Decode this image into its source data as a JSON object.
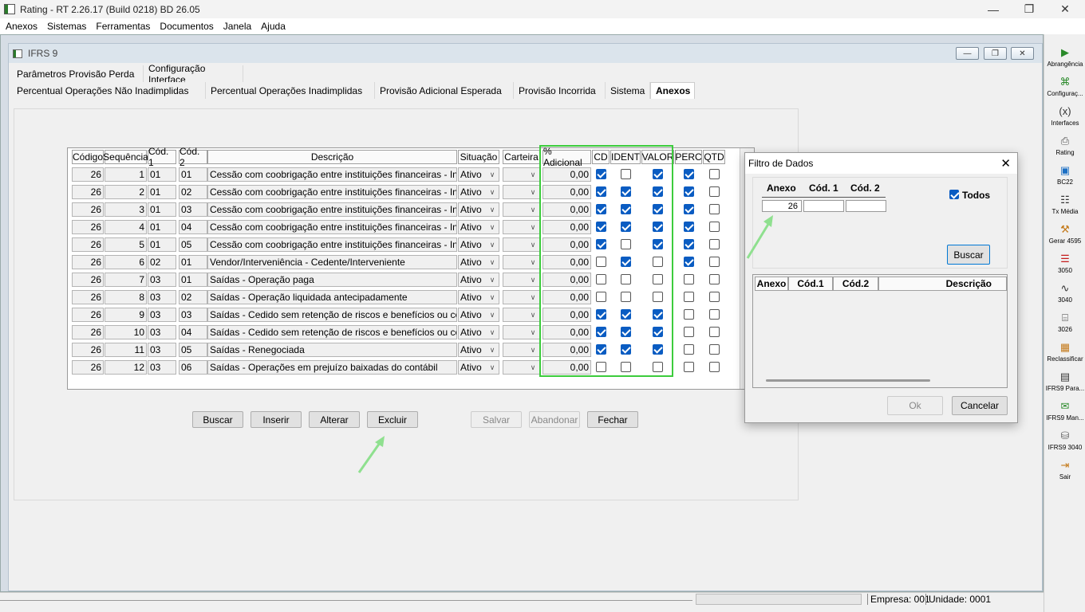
{
  "window": {
    "title": "Rating - RT 2.26.17 (Build 0218) BD 26.05"
  },
  "menu": [
    "Anexos",
    "Sistemas",
    "Ferramentas",
    "Documentos",
    "Janela",
    "Ajuda"
  ],
  "child": {
    "title": "IFRS 9"
  },
  "tabs_row1": [
    "Parâmetros Provisão Perda",
    "Configuração Interface"
  ],
  "tabs_row2": [
    "Percentual Operações Não Inadimplidas",
    "Percentual Operações Inadimplidas",
    "Provisão Adicional Esperada",
    "Provisão Incorrida",
    "Sistema",
    "Anexos"
  ],
  "active_tab": "Anexos",
  "grid": {
    "headers": [
      "Código",
      "Sequência",
      "Cód. 1",
      "Cód. 2",
      "Descrição",
      "Situação",
      "Carteira",
      "% Adicional",
      "CD",
      "IDENT",
      "VALOR",
      "PERC",
      "QTD"
    ],
    "rows": [
      {
        "codigo": "26",
        "seq": "1",
        "cod1": "01",
        "cod2": "01",
        "desc": "Cessão com coobrigação entre instituições financeiras - Informaç",
        "sit": "Ativo",
        "cart": "",
        "pct": "0,00",
        "cd": true,
        "ident": false,
        "valor": true,
        "perc": true,
        "qtd": false
      },
      {
        "codigo": "26",
        "seq": "2",
        "cod1": "01",
        "cod2": "02",
        "desc": "Cessão com coobrigação entre instituições financeiras - Informaç",
        "sit": "Ativo",
        "cart": "",
        "pct": "0,00",
        "cd": true,
        "ident": true,
        "valor": true,
        "perc": true,
        "qtd": false
      },
      {
        "codigo": "26",
        "seq": "3",
        "cod1": "01",
        "cod2": "03",
        "desc": "Cessão com coobrigação entre instituições financeiras - Informaç",
        "sit": "Ativo",
        "cart": "",
        "pct": "0,00",
        "cd": true,
        "ident": true,
        "valor": true,
        "perc": true,
        "qtd": false
      },
      {
        "codigo": "26",
        "seq": "4",
        "cod1": "01",
        "cod2": "04",
        "desc": "Cessão com coobrigação entre instituições financeiras - Informaç",
        "sit": "Ativo",
        "cart": "",
        "pct": "0,00",
        "cd": true,
        "ident": true,
        "valor": true,
        "perc": true,
        "qtd": false
      },
      {
        "codigo": "26",
        "seq": "5",
        "cod1": "01",
        "cod2": "05",
        "desc": "Cessão com coobrigação entre instituições financeiras -  Informaç",
        "sit": "Ativo",
        "cart": "",
        "pct": "0,00",
        "cd": true,
        "ident": false,
        "valor": true,
        "perc": true,
        "qtd": false
      },
      {
        "codigo": "26",
        "seq": "6",
        "cod1": "02",
        "cod2": "01",
        "desc": "Vendor/Interveniência - Cedente/Interveniente",
        "sit": "Ativo",
        "cart": "",
        "pct": "0,00",
        "cd": false,
        "ident": true,
        "valor": false,
        "perc": true,
        "qtd": false
      },
      {
        "codigo": "26",
        "seq": "7",
        "cod1": "03",
        "cod2": "01",
        "desc": "Saídas - Operação paga",
        "sit": "Ativo",
        "cart": "",
        "pct": "0,00",
        "cd": false,
        "ident": false,
        "valor": false,
        "perc": false,
        "qtd": false
      },
      {
        "codigo": "26",
        "seq": "8",
        "cod1": "03",
        "cod2": "02",
        "desc": "Saídas - Operação liquidada antecipadamente",
        "sit": "Ativo",
        "cart": "",
        "pct": "0,00",
        "cd": false,
        "ident": false,
        "valor": false,
        "perc": false,
        "qtd": false
      },
      {
        "codigo": "26",
        "seq": "9",
        "cod1": "03",
        "cod2": "03",
        "desc": "Saídas - Cedido sem retenção de riscos e benefícios ou controle",
        "sit": "Ativo",
        "cart": "",
        "pct": "0,00",
        "cd": true,
        "ident": true,
        "valor": true,
        "perc": false,
        "qtd": false
      },
      {
        "codigo": "26",
        "seq": "10",
        "cod1": "03",
        "cod2": "04",
        "desc": "Saídas - Cedido sem retenção de riscos e benefícios ou controle",
        "sit": "Ativo",
        "cart": "",
        "pct": "0,00",
        "cd": true,
        "ident": true,
        "valor": true,
        "perc": false,
        "qtd": false
      },
      {
        "codigo": "26",
        "seq": "11",
        "cod1": "03",
        "cod2": "05",
        "desc": "Saídas - Renegociada",
        "sit": "Ativo",
        "cart": "",
        "pct": "0,00",
        "cd": true,
        "ident": true,
        "valor": true,
        "perc": false,
        "qtd": false
      },
      {
        "codigo": "26",
        "seq": "12",
        "cod1": "03",
        "cod2": "06",
        "desc": "Saídas - Operações em prejuízo baixadas do contábil",
        "sit": "Ativo",
        "cart": "",
        "pct": "0,00",
        "cd": false,
        "ident": false,
        "valor": false,
        "perc": false,
        "qtd": false
      }
    ]
  },
  "buttons": {
    "buscar": "Buscar",
    "inserir": "Inserir",
    "alterar": "Alterar",
    "excluir": "Excluir",
    "salvar": "Salvar",
    "abandonar": "Abandonar",
    "fechar": "Fechar"
  },
  "sidebar": [
    {
      "label": "Abrangência",
      "icon": "arrow-right-icon"
    },
    {
      "label": "Configuraç...",
      "icon": "grid-config-icon"
    },
    {
      "label": "Interfaces",
      "icon": "function-icon"
    },
    {
      "label": "Rating",
      "icon": "printer-icon"
    },
    {
      "label": "BC22",
      "icon": "cube-icon"
    },
    {
      "label": "Tx Média",
      "icon": "network-icon"
    },
    {
      "label": "Gerar 4595",
      "icon": "wrench-icon"
    },
    {
      "label": "3050",
      "icon": "stack-icon"
    },
    {
      "label": "3040",
      "icon": "pulse-icon"
    },
    {
      "label": "3026",
      "icon": "document-icon"
    },
    {
      "label": "Reclassificar",
      "icon": "table-icon"
    },
    {
      "label": "IFRS9 Para...",
      "icon": "spreadsheet-icon"
    },
    {
      "label": "IFRS9 Man...",
      "icon": "email-icon"
    },
    {
      "label": "IFRS9 3040",
      "icon": "database-icon"
    },
    {
      "label": "Sair",
      "icon": "exit-icon"
    }
  ],
  "status": {
    "empresa": "Empresa: 001",
    "unidade": "Unidade: 0001"
  },
  "dialog": {
    "title": "Filtro de Dados",
    "anexo_label": "Anexo",
    "cod1_label": "Cód. 1",
    "cod2_label": "Cód. 2",
    "anexo_value": "26",
    "cod1_value": "",
    "cod2_value": "",
    "todos_label": "Todos",
    "todos_checked": true,
    "buscar": "Buscar",
    "list_headers": [
      "Anexo",
      "Cód.1",
      "Cód.2",
      "Descrição"
    ],
    "ok": "Ok",
    "cancelar": "Cancelar"
  }
}
